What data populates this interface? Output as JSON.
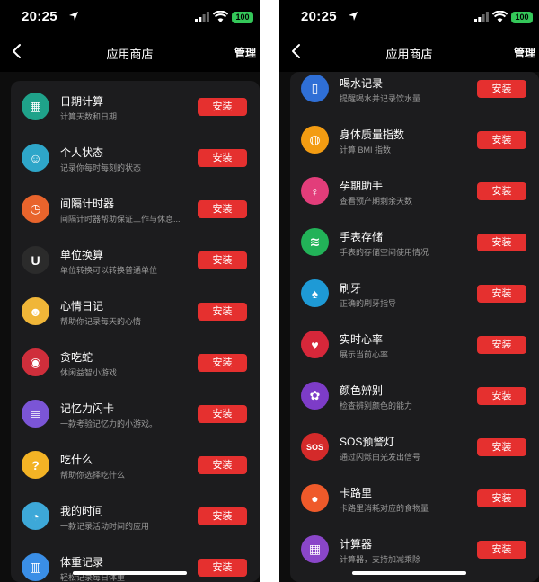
{
  "status": {
    "time": "20:25",
    "battery": "100"
  },
  "nav": {
    "title": "应用商店",
    "manage": "管理"
  },
  "left": {
    "apps": [
      {
        "name": "日期计算",
        "desc": "计算天数和日期",
        "color": "#1fa28a",
        "icon": "calendar-icon",
        "glyph": "▦",
        "action": "安装"
      },
      {
        "name": "个人状态",
        "desc": "记录你每时每刻的状态",
        "color": "#2ea6c9",
        "icon": "smiley-face-icon",
        "glyph": "☺",
        "action": "安装"
      },
      {
        "name": "间隔计时器",
        "desc": "间隔计时器帮助保证工作与休息...",
        "color": "#e8642c",
        "icon": "timer-clock-icon",
        "glyph": "◷",
        "action": "安装"
      },
      {
        "name": "单位换算",
        "desc": "单位转换可以转换普通单位",
        "color": "#2b2b2b",
        "icon": "unit-convert-icon",
        "glyph": "U",
        "action": "安装"
      },
      {
        "name": "心情日记",
        "desc": "帮助你记录每天的心情",
        "color": "#f0b638",
        "icon": "mood-faces-icon",
        "glyph": "☻",
        "action": "安装"
      },
      {
        "name": "贪吃蛇",
        "desc": "休闲益智小游戏",
        "color": "#cf2e3b",
        "icon": "snake-game-icon",
        "glyph": "◉",
        "action": "安装"
      },
      {
        "name": "记忆力闪卡",
        "desc": "一款考验记忆力的小游戏。",
        "color": "#7b55d6",
        "icon": "flash-card-icon",
        "glyph": "▤",
        "action": "安装"
      },
      {
        "name": "吃什么",
        "desc": "帮助你选择吃什么",
        "color": "#f3b325",
        "icon": "question-mark-icon",
        "glyph": "?",
        "action": "安装"
      },
      {
        "name": "我的时间",
        "desc": "一款记录活动时间的应用",
        "color": "#3da8d8",
        "icon": "time-ring-icon",
        "glyph": "◔",
        "action": "安装"
      },
      {
        "name": "体重记录",
        "desc": "轻松记录每日体重",
        "color": "#3a8ee6",
        "icon": "weight-scale-icon",
        "glyph": "▥",
        "action": "安装"
      }
    ]
  },
  "right": {
    "apps": [
      {
        "name": "喝水记录",
        "desc": "提醒喝水并记录饮水量",
        "color": "#2f6fd6",
        "icon": "water-glass-icon",
        "glyph": "▯",
        "action": "安装"
      },
      {
        "name": "身体质量指数",
        "desc": "计算 BMI 指数",
        "color": "#f39c12",
        "icon": "bmi-gauge-icon",
        "glyph": "◍",
        "action": "安装"
      },
      {
        "name": "孕期助手",
        "desc": "查看预产期剩余天数",
        "color": "#e23d7a",
        "icon": "pregnancy-icon",
        "glyph": "♀",
        "action": "安装"
      },
      {
        "name": "手表存储",
        "desc": "手表的存储空间使用情况",
        "color": "#22b258",
        "icon": "storage-database-icon",
        "glyph": "≋",
        "action": "安装"
      },
      {
        "name": "刷牙",
        "desc": "正确的刷牙指导",
        "color": "#1e9ad6",
        "icon": "tooth-icon",
        "glyph": "♠",
        "action": "安装"
      },
      {
        "name": "实时心率",
        "desc": "展示当前心率",
        "color": "#d6273a",
        "icon": "heart-rate-icon",
        "glyph": "♥",
        "action": "安装"
      },
      {
        "name": "颜色辨别",
        "desc": "检查辨别颜色的能力",
        "color": "#7d3cc8",
        "icon": "palette-icon",
        "glyph": "✿",
        "action": "安装"
      },
      {
        "name": "SOS预警灯",
        "desc": "通过闪烁白光发出信号",
        "color": "#d42a2a",
        "icon": "sos-icon",
        "glyph": "SOS",
        "action": "安装"
      },
      {
        "name": "卡路里",
        "desc": "卡路里消耗对应的食物量",
        "color": "#ef5a2a",
        "icon": "apple-calorie-icon",
        "glyph": "●",
        "action": "安装"
      },
      {
        "name": "计算器",
        "desc": "计算器，支持加减乘除",
        "color": "#8a46c9",
        "icon": "calculator-icon",
        "glyph": "▦",
        "action": "安装"
      }
    ]
  }
}
